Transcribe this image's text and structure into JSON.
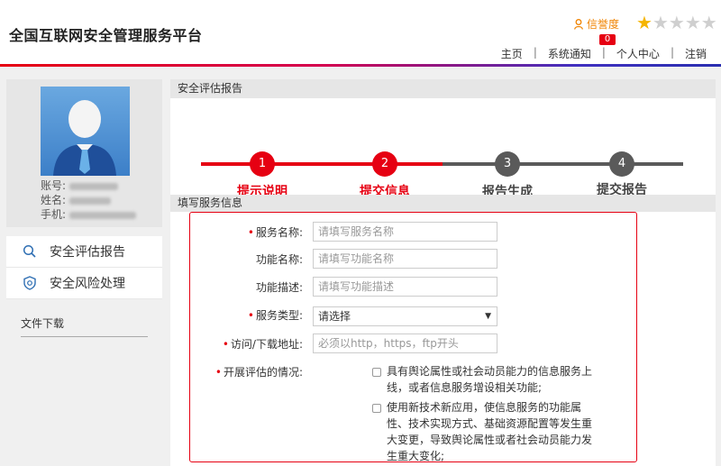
{
  "header": {
    "site_title": "全国互联网安全管理服务平台",
    "credit_label": "信誉度",
    "credit_count": "0",
    "rating": {
      "value": 1,
      "max": 5
    },
    "nav": [
      "主页",
      "系统通知",
      "个人中心",
      "注销"
    ]
  },
  "profile": {
    "account_label": "账号:",
    "name_label": "姓名:",
    "phone_label": "手机:"
  },
  "sidebar": {
    "items": [
      {
        "label": "安全评估报告",
        "icon": "search-icon"
      },
      {
        "label": "安全风险处理",
        "icon": "shield-icon"
      }
    ],
    "download": "文件下载"
  },
  "main": {
    "section_title": "安全评估报告",
    "steps": [
      {
        "num": "1",
        "label": "提示说明",
        "state": "done"
      },
      {
        "num": "2",
        "label": "提交信息",
        "state": "active"
      },
      {
        "num": "3",
        "label": "报告生成",
        "state": "pending"
      },
      {
        "num": "4",
        "label": "提交报告",
        "state": "pending"
      }
    ],
    "form_title": "填写服务信息",
    "fields": {
      "service_name": {
        "label": "服务名称:",
        "required": true,
        "placeholder": "请填写服务名称"
      },
      "function_name": {
        "label": "功能名称:",
        "required": false,
        "placeholder": "请填写功能名称"
      },
      "function_desc": {
        "label": "功能描述:",
        "required": false,
        "placeholder": "请填写功能描述"
      },
      "service_type": {
        "label": "服务类型:",
        "required": true,
        "value": "请选择"
      },
      "address": {
        "label": "访问/下载地址:",
        "required": true,
        "placeholder": "必须以http，https，ftp开头"
      },
      "situation": {
        "label": "开展评估的情况:",
        "required": true
      }
    },
    "options": [
      "具有舆论属性或社会动员能力的信息服务上线，或者信息服务增设相关功能;",
      "使用新技术新应用，使信息服务的功能属性、技术实现方式、基础资源配置等发生重大变更，导致舆论属性或者社会动员能力发生重大变化;"
    ]
  },
  "colors": {
    "accent": "#e60012",
    "pending": "#5a5a5a",
    "star": "#f5b500"
  }
}
